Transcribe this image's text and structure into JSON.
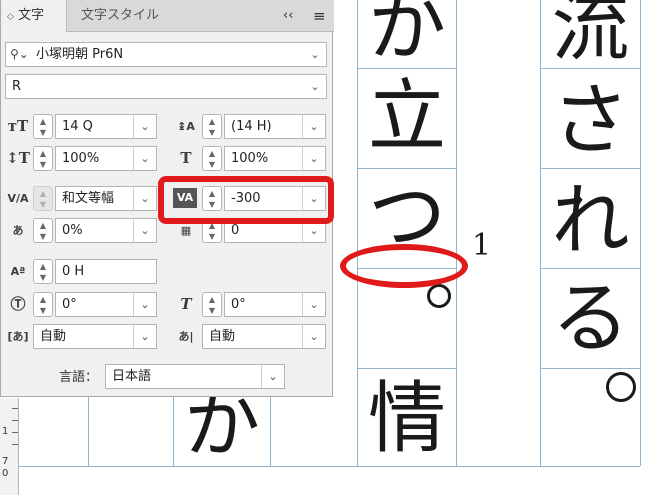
{
  "panel": {
    "tabs": [
      {
        "label": "文字",
        "active": true
      },
      {
        "label": "文字スタイル",
        "active": false
      }
    ],
    "collapse_label": "‹‹",
    "menu_label": "≡",
    "font_family": "小塚明朝 Pr6N",
    "font_style": "R",
    "font_size": "14 Q",
    "leading": "(14 H)",
    "vertical_scale": "100%",
    "horizontal_scale": "100%",
    "kerning": "和文等幅",
    "tracking": "-300",
    "tsume": "0%",
    "grid_count": "0",
    "baseline_shift": "0 H",
    "character_rotation": "0°",
    "skew": "0°",
    "aki_before": "自動",
    "aki_after": "自動",
    "language_label": "言語：",
    "language": "日本語"
  },
  "canvas": {
    "glyphs": [
      "か",
      "立",
      "つ",
      "流",
      "さ",
      "れ",
      "る",
      "情",
      "か"
    ],
    "footnote": "1",
    "ruler_numbers": [
      "1",
      "7",
      "0"
    ]
  },
  "colors": {
    "highlight": "#e01a1a",
    "guide": "#8fb4cc",
    "panel_bg": "#f0f0f0"
  }
}
